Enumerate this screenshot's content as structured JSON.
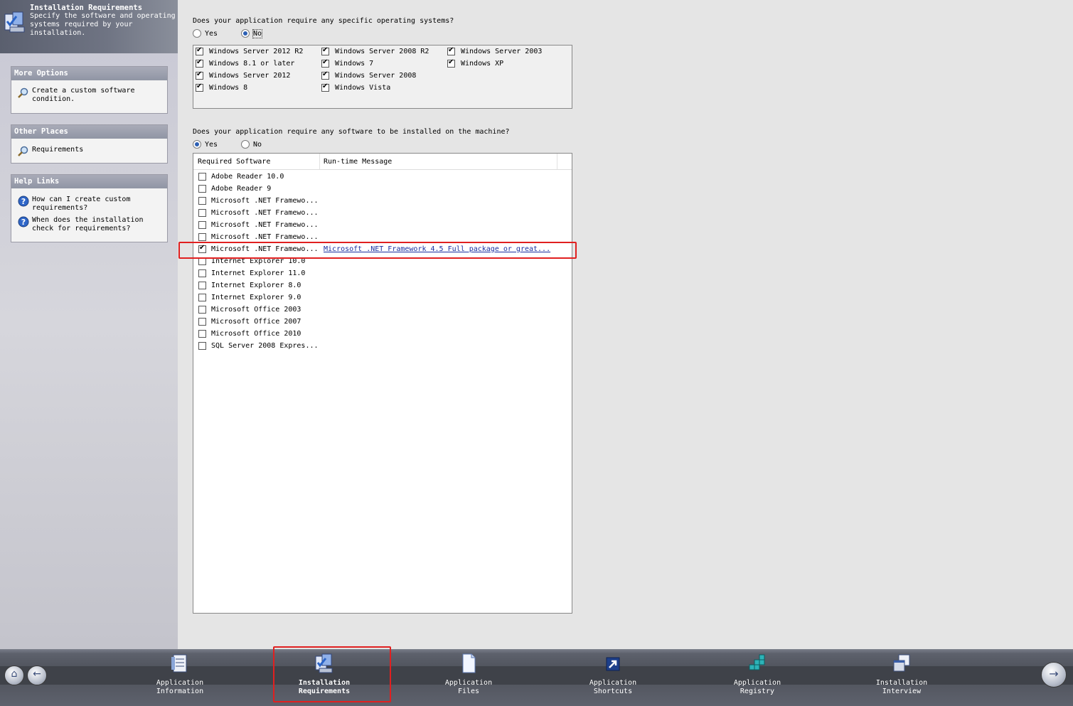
{
  "banner": {
    "title": "Installation Requirements",
    "description": "Specify the software and operating systems required by your installation."
  },
  "more_options": {
    "header": "More Options",
    "items": [
      {
        "label": "Create a custom software condition.",
        "icon": "search-icon"
      }
    ]
  },
  "other_places": {
    "header": "Other Places",
    "items": [
      {
        "label": "Requirements",
        "icon": "search-icon"
      }
    ]
  },
  "help_links": {
    "header": "Help Links",
    "items": [
      {
        "label": "How can I create custom requirements?",
        "icon": "help-icon"
      },
      {
        "label": "When does the installation check for requirements?",
        "icon": "help-icon"
      }
    ]
  },
  "os_question": {
    "text": "Does your application require any specific operating systems?",
    "yes": "Yes",
    "no": "No",
    "selected": "No"
  },
  "operating_systems": [
    {
      "label": "Windows Server 2012 R2",
      "checked": true
    },
    {
      "label": "Windows 8.1 or later",
      "checked": true
    },
    {
      "label": "Windows Server 2012",
      "checked": true
    },
    {
      "label": "Windows 8",
      "checked": true
    },
    {
      "label": "Windows Server 2008 R2",
      "checked": true
    },
    {
      "label": "Windows 7",
      "checked": true
    },
    {
      "label": "Windows Server 2008",
      "checked": true
    },
    {
      "label": "Windows Vista",
      "checked": true
    },
    {
      "label": "Windows Server 2003",
      "checked": true
    },
    {
      "label": "Windows XP",
      "checked": true
    }
  ],
  "sw_question": {
    "text": "Does your application require any software to be installed on the machine?",
    "yes": "Yes",
    "no": "No",
    "selected": "Yes"
  },
  "software_table": {
    "columns": [
      "Required Software",
      "Run-time Message"
    ],
    "rows": [
      {
        "name": "Adobe Reader 10.0",
        "checked": false,
        "message": ""
      },
      {
        "name": "Adobe Reader 9",
        "checked": false,
        "message": ""
      },
      {
        "name": "Microsoft .NET Framewo...",
        "checked": false,
        "message": ""
      },
      {
        "name": "Microsoft .NET Framewo...",
        "checked": false,
        "message": ""
      },
      {
        "name": "Microsoft .NET Framewo...",
        "checked": false,
        "message": ""
      },
      {
        "name": "Microsoft .NET Framewo...",
        "checked": false,
        "message": ""
      },
      {
        "name": "Microsoft .NET Framewo...",
        "checked": true,
        "message": "Microsoft .NET Framework 4.5 Full package or great..."
      },
      {
        "name": "Internet Explorer 10.0",
        "checked": false,
        "message": ""
      },
      {
        "name": "Internet Explorer 11.0",
        "checked": false,
        "message": ""
      },
      {
        "name": "Internet Explorer 8.0",
        "checked": false,
        "message": ""
      },
      {
        "name": "Internet Explorer 9.0",
        "checked": false,
        "message": ""
      },
      {
        "name": "Microsoft Office 2003",
        "checked": false,
        "message": ""
      },
      {
        "name": "Microsoft Office 2007",
        "checked": false,
        "message": ""
      },
      {
        "name": "Microsoft Office 2010",
        "checked": false,
        "message": ""
      },
      {
        "name": "SQL Server 2008 Expres...",
        "checked": false,
        "message": ""
      }
    ]
  },
  "steps": [
    {
      "line1": "Application",
      "line2": "Information",
      "icon": "application-information-icon",
      "current": false
    },
    {
      "line1": "Installation",
      "line2": "Requirements",
      "icon": "installation-requirements-icon",
      "current": true
    },
    {
      "line1": "Application",
      "line2": "Files",
      "icon": "application-files-icon",
      "current": false
    },
    {
      "line1": "Application",
      "line2": "Shortcuts",
      "icon": "application-shortcuts-icon",
      "current": false
    },
    {
      "line1": "Application",
      "line2": "Registry",
      "icon": "application-registry-icon",
      "current": false
    },
    {
      "line1": "Installation",
      "line2": "Interview",
      "icon": "installation-interview-icon",
      "current": false
    }
  ],
  "nav": {
    "home_icon": "home-icon",
    "back_icon": "back-arrow-icon",
    "next_icon": "next-arrow-icon"
  },
  "colors": {
    "highlight": "#e02020",
    "link": "#1a2fa0",
    "radio_selected": "#2c5fb3"
  }
}
